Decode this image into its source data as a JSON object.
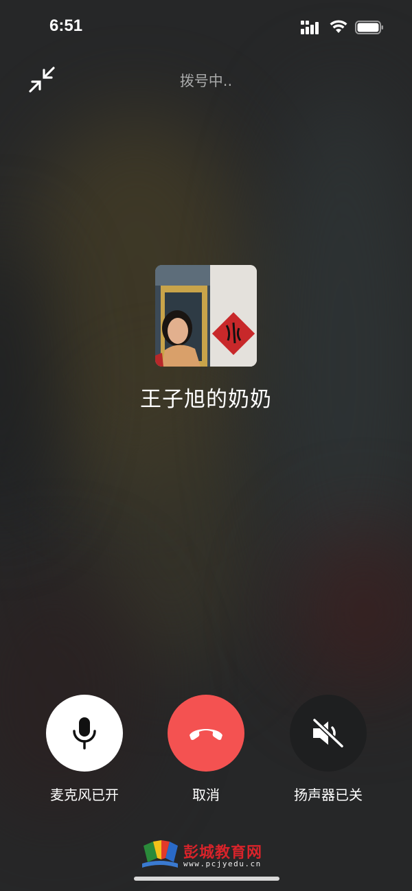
{
  "status_bar": {
    "time": "6:51"
  },
  "call": {
    "status": "拨号中..",
    "caller_name": "王子旭的奶奶"
  },
  "controls": {
    "mic_label": "麦克风已开",
    "cancel_label": "取消",
    "speaker_label": "扬声器已关"
  },
  "watermark": {
    "title": "彭城教育网",
    "url": "www.pcjyedu.cn"
  },
  "colors": {
    "cancel_red": "#f45251",
    "mic_bg": "#ffffff",
    "speaker_bg": "#1e1f20",
    "watermark_red": "#d8232a"
  },
  "icons": {
    "minimize": "minimize-arrows-icon",
    "mic": "microphone-icon",
    "cancel": "hang-up-phone-icon",
    "speaker": "speaker-muted-icon",
    "signal": "cellular-signal-icon",
    "wifi": "wifi-icon",
    "battery": "battery-icon"
  }
}
